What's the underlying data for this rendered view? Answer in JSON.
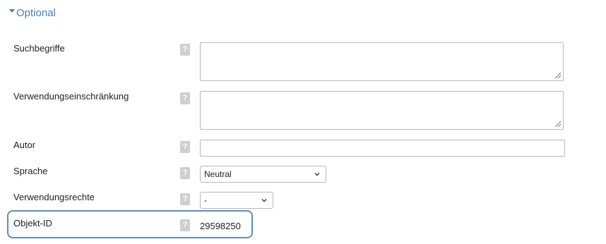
{
  "section": {
    "title": "Optional"
  },
  "fields": {
    "suchbegriffe": {
      "label": "Suchbegriffe",
      "value": ""
    },
    "verwendungseinschraenkung": {
      "label": "Verwendungseinschränkung",
      "value": ""
    },
    "autor": {
      "label": "Autor",
      "value": ""
    },
    "sprache": {
      "label": "Sprache",
      "selected": "Neutral"
    },
    "verwendungsrechte": {
      "label": "Verwendungsrechte",
      "selected": "-"
    },
    "objekt_id": {
      "label": "Objekt-ID",
      "value": "29598250"
    }
  },
  "help_icon": "?",
  "colors": {
    "accent": "#4a7fb8",
    "highlight_border": "#5e8db3",
    "help_bg": "#cfcfcf",
    "input_border": "#b8b8b8"
  }
}
